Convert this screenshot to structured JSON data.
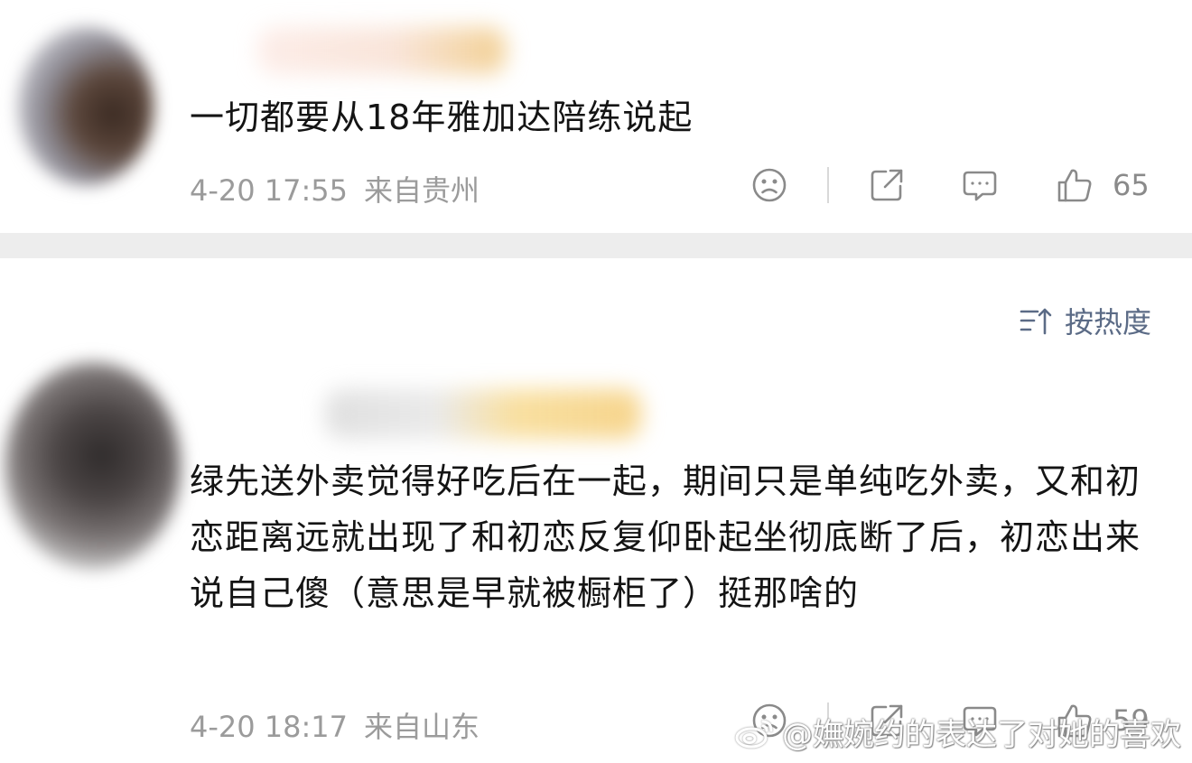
{
  "comments": [
    {
      "text": "一切都要从18年雅加达陪练说起",
      "timestamp": "4-20 17:55",
      "location": "来自贵州",
      "likes": "65"
    },
    {
      "text": "绿先送外卖觉得好吃后在一起，期间只是单纯吃外卖，又和初恋距离远就出现了和初恋反复仰卧起坐彻底断了后，初恋出来说自己傻（意思是早就被橱柜了）挺那啥的",
      "timestamp": "4-20 18:17",
      "location": "来自山东",
      "likes": "59"
    }
  ],
  "sort": {
    "label": "按热度"
  },
  "watermark": {
    "text": "@嫵婉约的表达了对她的喜欢"
  },
  "icons": {
    "dislike": "sad-face-icon",
    "share": "share-icon",
    "reply": "comment-bubble-icon",
    "like": "thumbs-up-icon",
    "sort": "sort-icon",
    "watermark_logo": "weibo-logo-icon"
  },
  "colors": {
    "separator": "#ededed",
    "meta_text": "#9b9b9b",
    "sort_text": "#5b6b86",
    "icon": "#8a8a8a"
  }
}
